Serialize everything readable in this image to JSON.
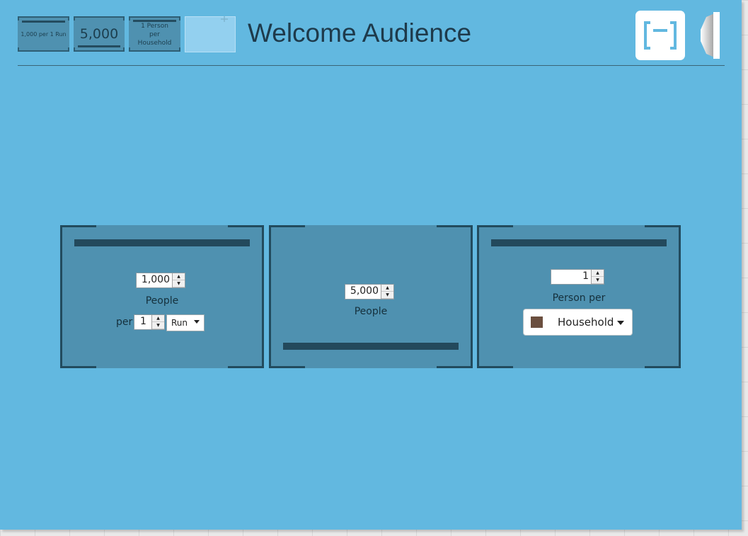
{
  "header": {
    "title": "Welcome Audience",
    "thumbnails": [
      {
        "label": "1,000 per 1 Run"
      },
      {
        "label": "5,000"
      },
      {
        "label": "1 Person per Household"
      }
    ],
    "new_thumbnail_icon": "plus-icon",
    "control_button_icon": "bracket-minus-icon",
    "side_tab_icon": "side-panel-tab-icon"
  },
  "cards": [
    {
      "people_value": "1,000",
      "people_label": "People",
      "per_label": "per",
      "per_value": "1",
      "unit_value": "Run"
    },
    {
      "people_value": "5,000",
      "people_label": "People"
    },
    {
      "person_value": "1",
      "person_per_label": "Person per",
      "dropdown_value": "Household",
      "dropdown_swatch_color": "#6b4f3f"
    }
  ],
  "colors": {
    "background": "#62b8e0",
    "card": "#4f91b0",
    "card_border": "#224b5e"
  }
}
